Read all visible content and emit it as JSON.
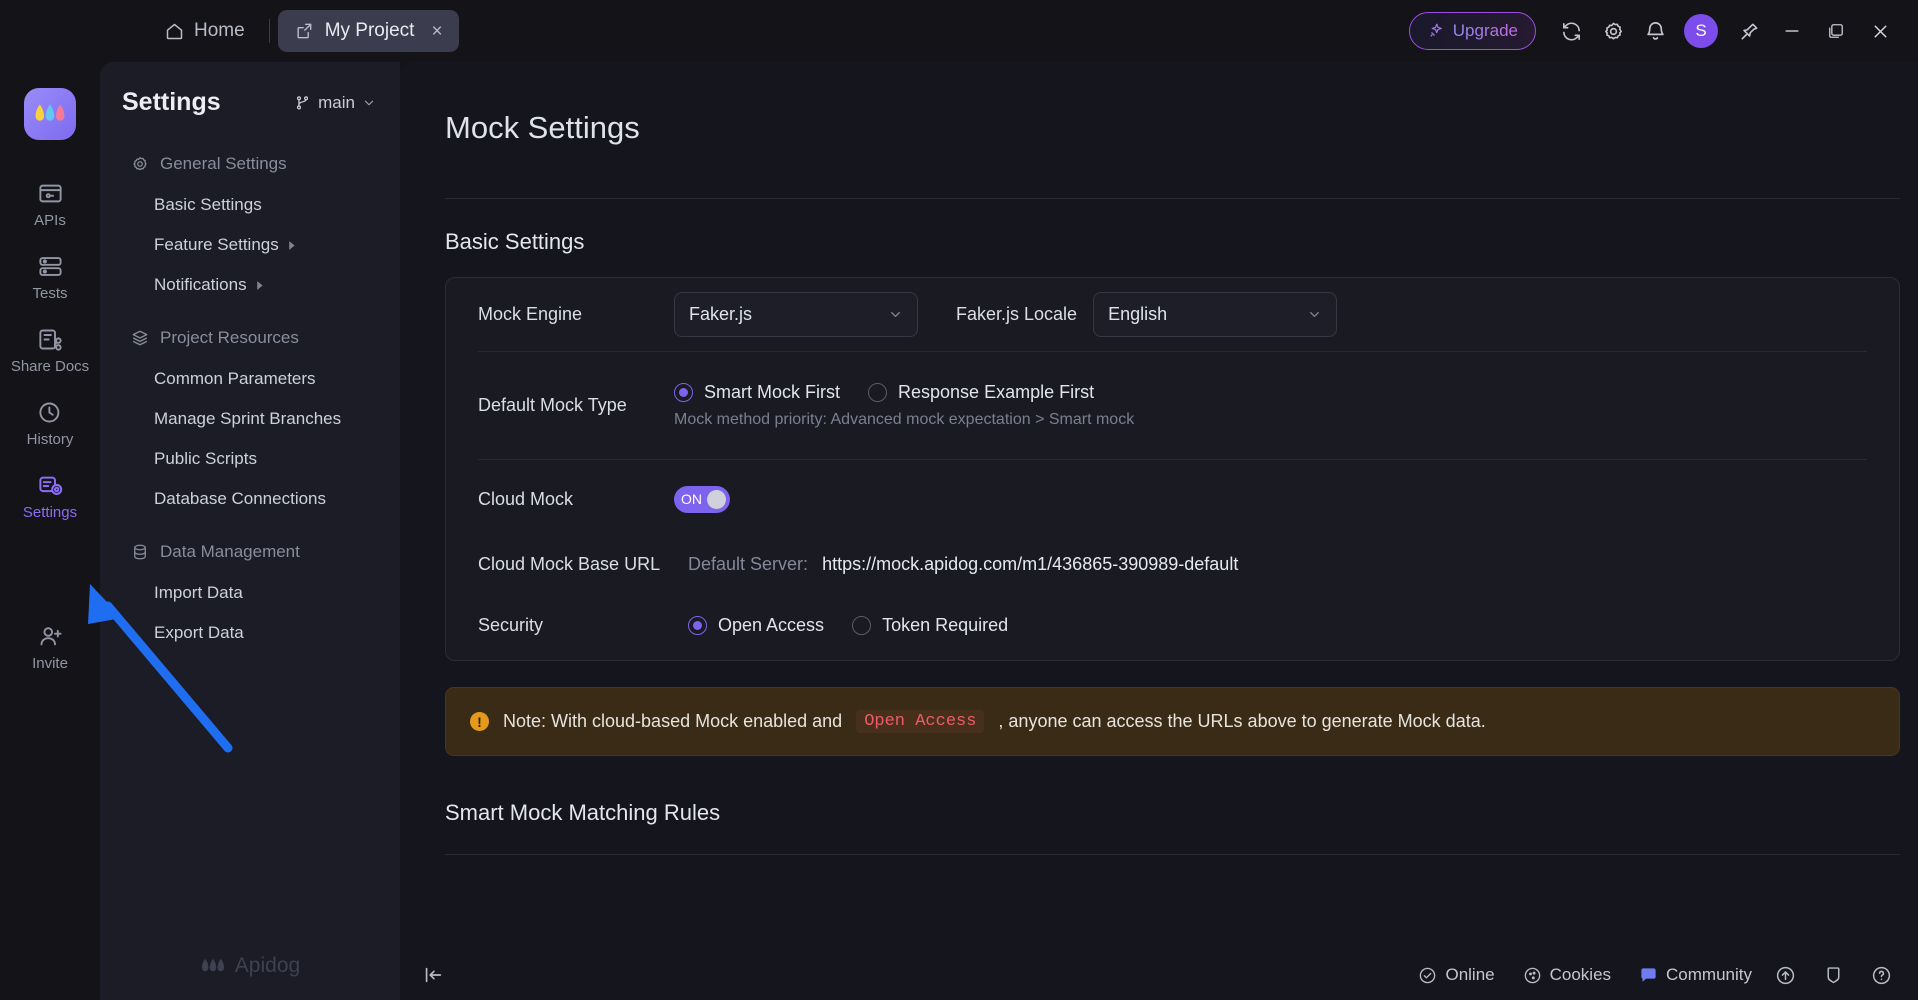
{
  "titlebar": {
    "home_tab": "Home",
    "project_tab": "My Project",
    "close_tab": "×",
    "upgrade": "Upgrade",
    "avatar_initial": "S",
    "minimize": "—",
    "close": "✕"
  },
  "rail": {
    "items": [
      {
        "label": "APIs",
        "icon": "apis-icon",
        "active": false
      },
      {
        "label": "Tests",
        "icon": "tests-icon",
        "active": false
      },
      {
        "label": "Share Docs",
        "icon": "share-docs-icon",
        "active": false
      },
      {
        "label": "History",
        "icon": "history-icon",
        "active": false
      },
      {
        "label": "Settings",
        "icon": "settings-icon",
        "active": true
      },
      {
        "label": "Invite",
        "icon": "invite-icon",
        "active": false
      }
    ]
  },
  "panel": {
    "title": "Settings",
    "branch": "main",
    "footer_brand": "Apidog",
    "groups": [
      {
        "label": "General Settings",
        "icon": "gear-icon",
        "items": [
          {
            "label": "Basic Settings",
            "caret": false
          },
          {
            "label": "Feature Settings",
            "caret": true
          },
          {
            "label": "Notifications",
            "caret": true
          }
        ]
      },
      {
        "label": "Project Resources",
        "icon": "layers-icon",
        "items": [
          {
            "label": "Common Parameters",
            "caret": false
          },
          {
            "label": "Manage Sprint Branches",
            "caret": false
          },
          {
            "label": "Public Scripts",
            "caret": false
          },
          {
            "label": "Database Connections",
            "caret": false
          }
        ]
      },
      {
        "label": "Data Management",
        "icon": "database-icon",
        "items": [
          {
            "label": "Import Data",
            "caret": false
          },
          {
            "label": "Export Data",
            "caret": false
          }
        ]
      }
    ]
  },
  "main": {
    "page_title": "Mock Settings",
    "basic_section": "Basic Settings",
    "mock_engine": {
      "label": "Mock Engine",
      "value": "Faker.js",
      "locale_label": "Faker.js Locale",
      "locale_value": "English"
    },
    "default_mock_type": {
      "label": "Default Mock Type",
      "option_a": "Smart Mock First",
      "option_b": "Response Example First",
      "hint": "Mock method priority: Advanced mock expectation > Smart mock"
    },
    "cloud_mock": {
      "label": "Cloud Mock",
      "toggle_state": "ON"
    },
    "cloud_mock_base_url": {
      "label": "Cloud Mock Base URL",
      "server_label": "Default Server:",
      "url": "https://mock.apidog.com/m1/436865-390989-default"
    },
    "security": {
      "label": "Security",
      "option_a": "Open Access",
      "option_b": "Token Required"
    },
    "note": {
      "prefix": "Note: With cloud-based Mock enabled and",
      "code": "Open Access",
      "suffix": ", anyone can access the URLs above to generate Mock data."
    },
    "smart_mock_section": "Smart Mock Matching Rules"
  },
  "status": {
    "collapse": "⇤",
    "online": "Online",
    "cookies": "Cookies",
    "community": "Community"
  },
  "colors": {
    "accent": "#7e63ef",
    "upgrade_border": "#9a4fe0",
    "note_bg": "#3a2b17",
    "code_text": "#ef5a6a",
    "arrow": "#1f6df0"
  }
}
